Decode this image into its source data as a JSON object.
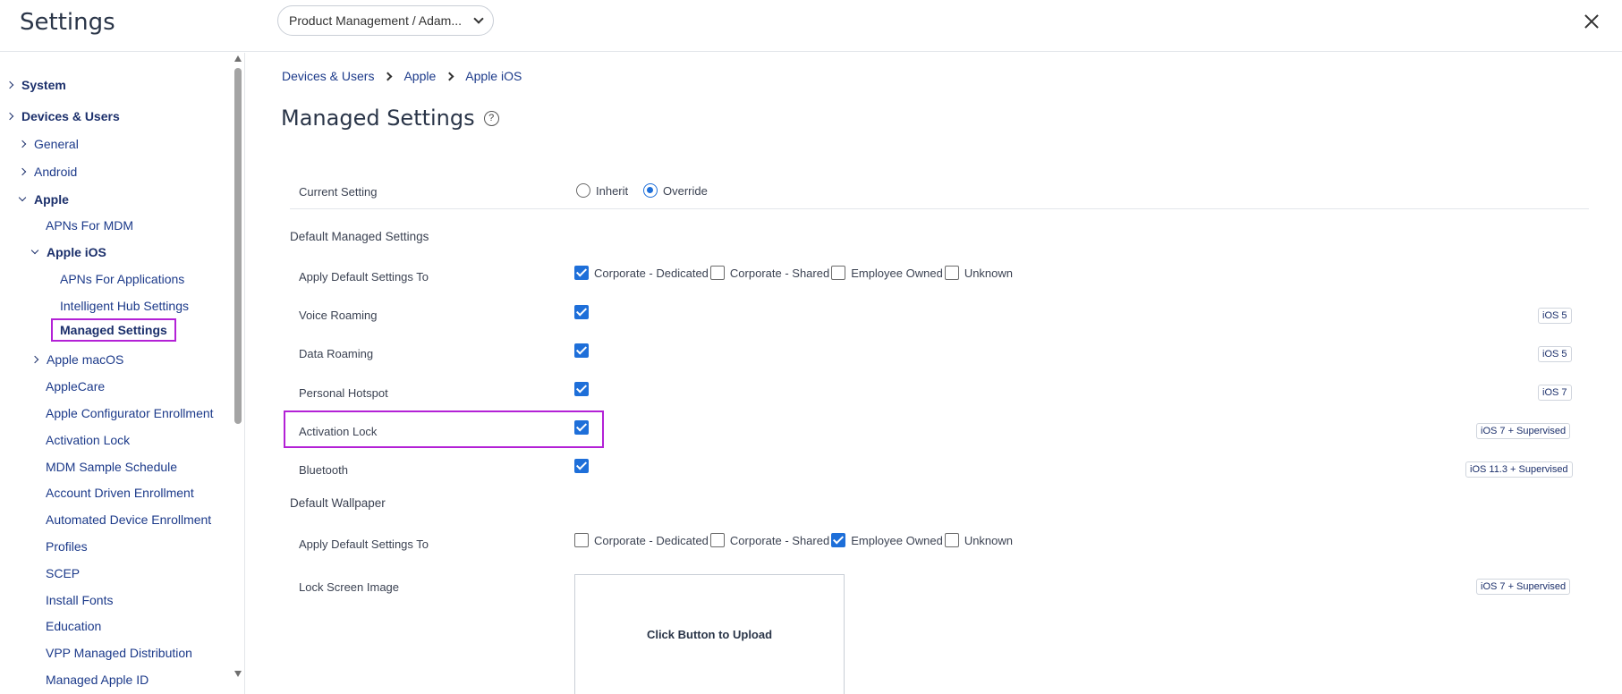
{
  "header": {
    "title": "Settings",
    "org_selector": "Product Management / Adam..."
  },
  "sidebar": {
    "items": [
      {
        "label": "System"
      },
      {
        "label": "Devices & Users"
      },
      {
        "label": "General"
      },
      {
        "label": "Android"
      },
      {
        "label": "Apple"
      },
      {
        "label": "APNs For MDM"
      },
      {
        "label": "Apple iOS"
      },
      {
        "label": "APNs For Applications"
      },
      {
        "label": "Intelligent Hub Settings"
      },
      {
        "label": "Managed Settings"
      },
      {
        "label": "Apple macOS"
      },
      {
        "label": "AppleCare"
      },
      {
        "label": "Apple Configurator Enrollment"
      },
      {
        "label": "Activation Lock"
      },
      {
        "label": "MDM Sample Schedule"
      },
      {
        "label": "Account Driven Enrollment"
      },
      {
        "label": "Automated Device Enrollment"
      },
      {
        "label": "Profiles"
      },
      {
        "label": "SCEP"
      },
      {
        "label": "Install Fonts"
      },
      {
        "label": "Education"
      },
      {
        "label": "VPP Managed Distribution"
      },
      {
        "label": "Managed Apple ID"
      }
    ]
  },
  "breadcrumb": [
    "Devices & Users",
    "Apple",
    "Apple iOS"
  ],
  "page": {
    "title": "Managed Settings",
    "help_icon": "?"
  },
  "form": {
    "current_setting": {
      "label": "Current Setting",
      "options": [
        "Inherit",
        "Override"
      ],
      "selected": "Override"
    },
    "section_default_managed": "Default Managed Settings",
    "apply_default_1": {
      "label": "Apply Default Settings To",
      "options": [
        {
          "label": "Corporate - Dedicated",
          "checked": true
        },
        {
          "label": "Corporate - Shared",
          "checked": false
        },
        {
          "label": "Employee Owned",
          "checked": false
        },
        {
          "label": "Unknown",
          "checked": false
        }
      ]
    },
    "voice_roaming": {
      "label": "Voice Roaming",
      "checked": true,
      "badge": "iOS 5"
    },
    "data_roaming": {
      "label": "Data Roaming",
      "checked": true,
      "badge": "iOS 5"
    },
    "personal_hotspot": {
      "label": "Personal Hotspot",
      "checked": true,
      "badge": "iOS 7"
    },
    "activation_lock": {
      "label": "Activation Lock",
      "checked": true,
      "badge": "iOS 7 + Supervised"
    },
    "bluetooth": {
      "label": "Bluetooth",
      "checked": true,
      "badge": "iOS 11.3 + Supervised"
    },
    "section_wallpaper": "Default Wallpaper",
    "apply_default_2": {
      "label": "Apply Default Settings To",
      "options": [
        {
          "label": "Corporate - Dedicated",
          "checked": false
        },
        {
          "label": "Corporate - Shared",
          "checked": false
        },
        {
          "label": "Employee Owned",
          "checked": true
        },
        {
          "label": "Unknown",
          "checked": false
        }
      ]
    },
    "lock_screen": {
      "label": "Lock Screen Image",
      "badge": "iOS 7 + Supervised",
      "upload_text": "Click Button to Upload"
    }
  },
  "colors": {
    "accent": "#1e6fd9",
    "highlight": "#b321d6",
    "nav_text": "#1c3a8a"
  }
}
